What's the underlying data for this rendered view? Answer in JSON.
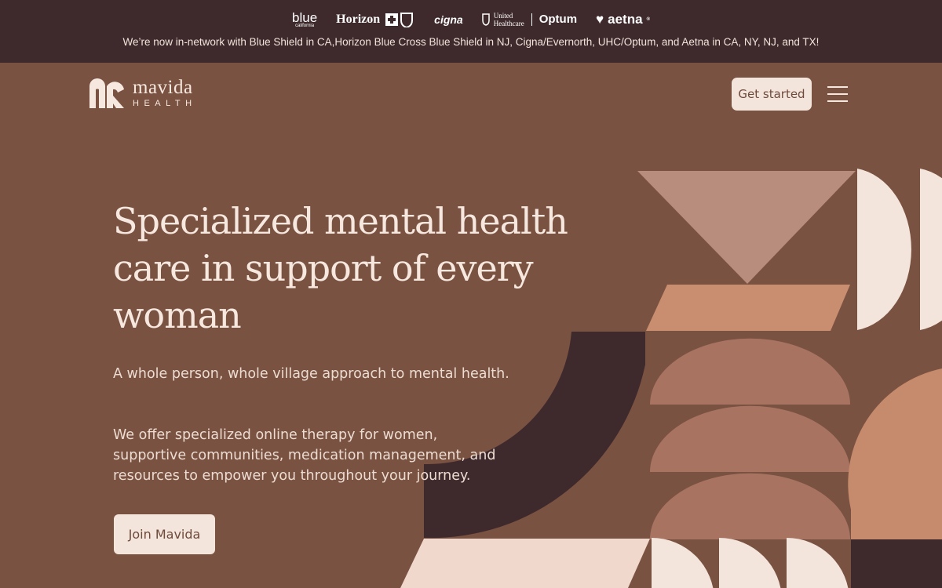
{
  "banner": {
    "logos": {
      "blue": "blue",
      "blue_sub": "california",
      "horizon": "Horizon",
      "cigna": "cigna",
      "uhc_line1": "United",
      "uhc_line2": "Healthcare",
      "optum": "Optum",
      "aetna": "aetna",
      "aetna_reg": "®"
    },
    "message": "We’re now in-network with Blue Shield in CA,Horizon Blue Cross Blue Shield in NJ, Cigna/Evernorth, UHC/Optum, and Aetna in CA, NY, NJ, and TX!"
  },
  "nav": {
    "brand_name": "mavida",
    "brand_sub": "HEALTH",
    "cta_label": "Get started",
    "menu_icon": "hamburger-menu-icon"
  },
  "hero": {
    "title": "Specialized mental health care in support of every woman",
    "paragraph1": "A whole person, whole village approach to mental health.",
    "paragraph2": "We offer specialized online therapy for women, supportive communities, medication management, and resources to empower you throughout your journey.",
    "button_label": "Join Mavida"
  },
  "colors": {
    "background": "#7a5241",
    "banner": "#3e2a2c",
    "cream": "#f3e5dc",
    "dark_shape": "#3e2a2c",
    "tan": "#c68a6c",
    "mocha": "#9a6b58"
  }
}
